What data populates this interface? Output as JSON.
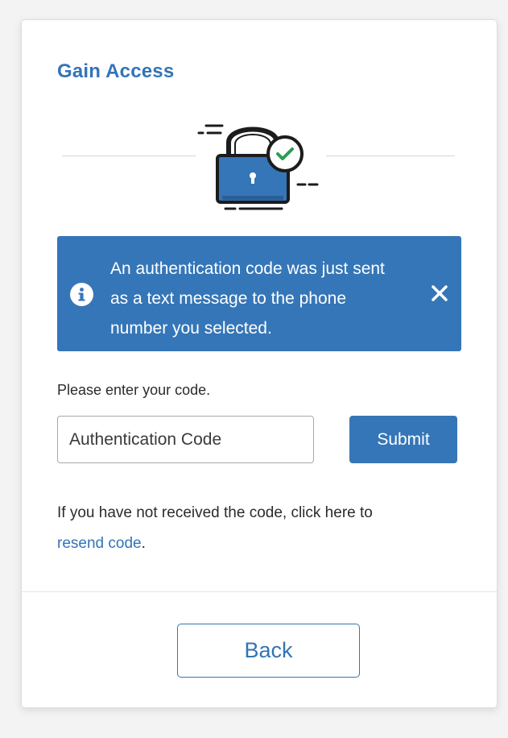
{
  "header": {
    "title": "Gain Access"
  },
  "alert": {
    "message": "An authentication code was just sent as a text message to the phone number you selected.",
    "icon": "info-icon",
    "close_icon": "close-icon",
    "color": "#3576b8"
  },
  "form": {
    "prompt": "Please enter your code.",
    "code_placeholder": "Authentication Code",
    "submit_label": "Submit"
  },
  "resend": {
    "text": "If you have not received the code, click here to",
    "link_text": "resend code",
    "suffix": "."
  },
  "footer": {
    "back_label": "Back"
  },
  "colors": {
    "accent": "#3374b7",
    "alert_bg": "#3576b8",
    "success": "#2e9b55"
  }
}
